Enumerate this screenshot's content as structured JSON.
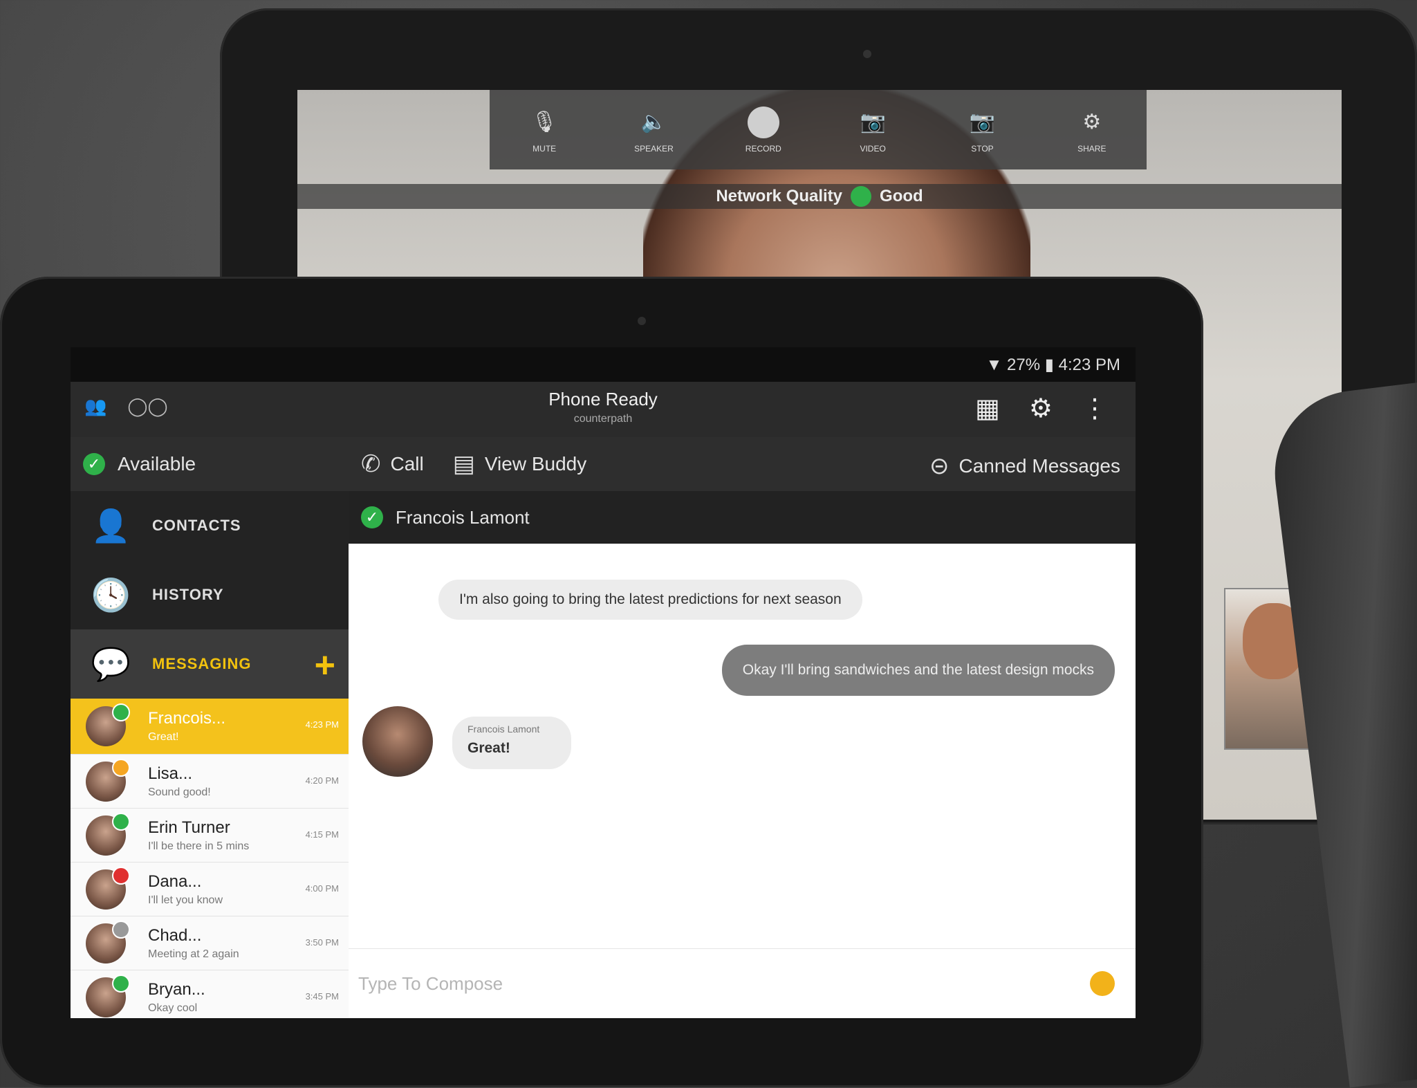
{
  "video_call": {
    "toolbar": [
      {
        "icon": "microphone-icon",
        "label": "MUTE",
        "color": "#dddddd"
      },
      {
        "icon": "speaker-icon",
        "label": "SPEAKER",
        "color": "#f2c20e"
      },
      {
        "icon": "record-icon",
        "label": "RECORD",
        "color": "#cccccc"
      },
      {
        "icon": "camera-icon",
        "label": "VIDEO",
        "color": "#f2c20e"
      },
      {
        "icon": "camera-off-icon",
        "label": "STOP",
        "color": "#e05050"
      },
      {
        "icon": "share-icon",
        "label": "SHARE",
        "color": "#dddddd"
      }
    ],
    "network_label": "Network Quality",
    "network_status": "Good"
  },
  "status_bar": {
    "text": "▼ 27% ▮ 4:23 PM"
  },
  "header": {
    "title": "Phone Ready",
    "subtitle": "counterpath",
    "left_icons": [
      "contacts-icon",
      "voicemail-icon"
    ],
    "right_icons": [
      "dialpad-icon",
      "settings-icon",
      "more-icon"
    ]
  },
  "presence": {
    "label": "Available"
  },
  "nav": {
    "contacts": "CONTACTS",
    "history": "HISTORY",
    "messaging": "MESSAGING"
  },
  "actions": {
    "call": "Call",
    "view_buddy": "View Buddy",
    "canned": "Canned Messages"
  },
  "conversations": [
    {
      "name": "Francois...",
      "snippet": "Great!",
      "time": "4:23 PM",
      "active": true,
      "presence_color": "#2fb14a"
    },
    {
      "name": "Lisa...",
      "snippet": "Sound good!",
      "time": "4:20 PM",
      "active": false,
      "presence_color": "#f5a623"
    },
    {
      "name": "Erin Turner",
      "snippet": "I'll be there in 5 mins",
      "time": "4:15 PM",
      "active": false,
      "presence_color": "#2fb14a"
    },
    {
      "name": "Dana...",
      "snippet": "I'll let you know",
      "time": "4:00 PM",
      "active": false,
      "presence_color": "#e03030"
    },
    {
      "name": "Chad...",
      "snippet": "Meeting at 2 again",
      "time": "3:50 PM",
      "active": false,
      "presence_color": "#999999"
    },
    {
      "name": "Bryan...",
      "snippet": "Okay cool",
      "time": "3:45 PM",
      "active": false,
      "presence_color": "#2fb14a"
    }
  ],
  "chat": {
    "contact_name": "Francois Lamont",
    "messages": [
      {
        "direction": "in",
        "text": "I'm also going to bring the latest predictions for next season"
      },
      {
        "direction": "out",
        "text": "Okay I'll bring sandwiches and the latest design mocks"
      },
      {
        "direction": "in",
        "sender": "Francois Lamont",
        "text": "Great!"
      }
    ],
    "composer_placeholder": "Type To Compose"
  },
  "colors": {
    "accent": "#f2c20e",
    "available": "#2fb14a"
  }
}
